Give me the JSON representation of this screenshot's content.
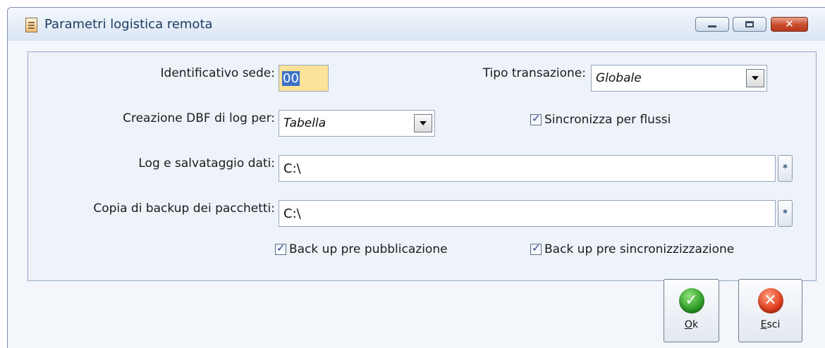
{
  "window": {
    "title": "Parametri logistica remota",
    "controls": {
      "minimize": "minimize",
      "maximize": "maximize",
      "close": "✕"
    }
  },
  "form": {
    "identificativo_sede": {
      "label": "Identificativo sede:",
      "value": "00"
    },
    "tipo_transazione": {
      "label": "Tipo transazione:",
      "value": "Globale"
    },
    "creazione_dbf": {
      "label": "Creazione DBF di log per:",
      "value": "Tabella"
    },
    "sincronizza_flussi": {
      "label": "Sincronizza per flussi",
      "checked": true
    },
    "log_salvataggio": {
      "label": "Log e salvataggio dati:",
      "value": "C:\\",
      "browse": "*"
    },
    "copia_backup": {
      "label": "Copia di backup dei pacchetti:",
      "value": "C:\\",
      "browse": "*"
    },
    "backup_pubblicazione": {
      "label": "Back up pre pubblicazione",
      "checked": true
    },
    "backup_sincronizzazione": {
      "label": "Back up pre sincronizzizzazione",
      "checked": true
    }
  },
  "buttons": {
    "ok": {
      "accel": "O",
      "rest": "k",
      "icon": "ok-check-icon",
      "color": "#2e9e26"
    },
    "esci": {
      "accel": "E",
      "rest": "sci",
      "icon": "cancel-x-icon",
      "color": "#e0401e"
    }
  },
  "colors": {
    "title_text": "#1e3a5f",
    "field_highlight": "#fde29a",
    "group_border": "#97a9c4"
  }
}
